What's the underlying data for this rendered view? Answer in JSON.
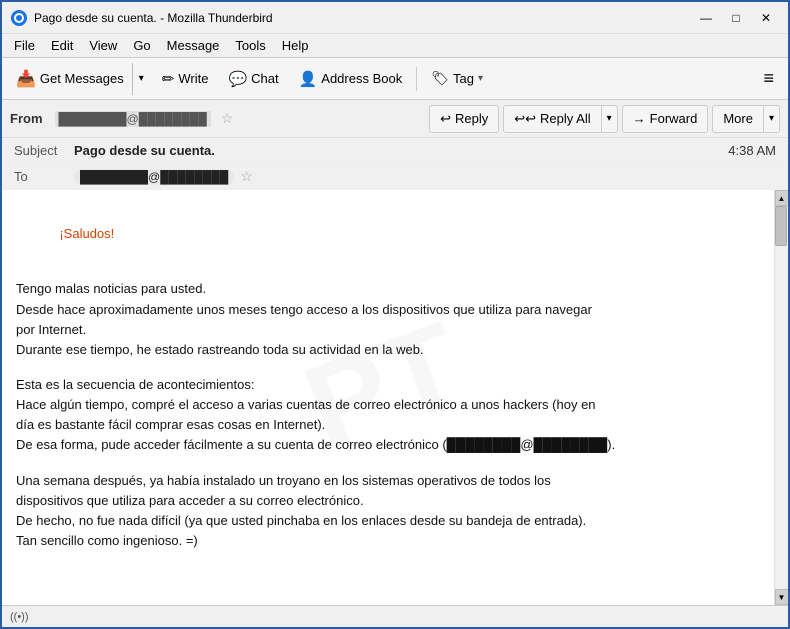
{
  "window": {
    "title": "Pago desde su cuenta. - Mozilla Thunderbird"
  },
  "titlebar": {
    "minimize_label": "—",
    "maximize_label": "□",
    "close_label": "✕"
  },
  "menubar": {
    "items": [
      {
        "label": "File"
      },
      {
        "label": "Edit"
      },
      {
        "label": "View"
      },
      {
        "label": "Go"
      },
      {
        "label": "Message"
      },
      {
        "label": "Tools"
      },
      {
        "label": "Help"
      }
    ]
  },
  "toolbar": {
    "get_messages_label": "Get Messages",
    "write_label": "Write",
    "chat_label": "Chat",
    "address_book_label": "Address Book",
    "tag_label": "Tag",
    "hamburger_label": "≡"
  },
  "action_bar": {
    "from_label": "From",
    "from_email": "████████@████████",
    "reply_label": "Reply",
    "reply_all_label": "Reply All",
    "forward_label": "Forward",
    "more_label": "More"
  },
  "email_meta": {
    "subject_label": "Subject",
    "subject_value": "Pago desde su cuenta.",
    "time": "4:38 AM",
    "to_label": "To",
    "to_email": "████████@████████"
  },
  "email_body": {
    "greeting": "¡Saludos!",
    "paragraph1": "Tengo malas noticias para usted.\nDesde hace aproximadamente unos meses tengo acceso a los dispositivos que utiliza para navegar\npor Internet.\nDurante ese tiempo, he estado rastreando toda su actividad en la web.",
    "paragraph2": "Esta es la secuencia de acontecimientos:\nHace algún tiempo, compré el acceso a varias cuentas de correo electrónico a unos hackers (hoy en\ndía es bastante fácil comprar esas cosas en Internet).\nDe esa forma, pude acceder fácilmente a su cuenta de correo electrónico (████████@████████).",
    "paragraph3": "Una semana después, ya había instalado un troyano en los sistemas operativos de todos los\ndispositivos que utiliza para acceder a su correo electrónico.\nDe hecho, no fue nada difícil (ya que usted pinchaba en los enlaces desde su bandeja de entrada).\nTan sencillo como ingenioso. =)"
  },
  "status_bar": {
    "wifi_label": "((•))"
  }
}
